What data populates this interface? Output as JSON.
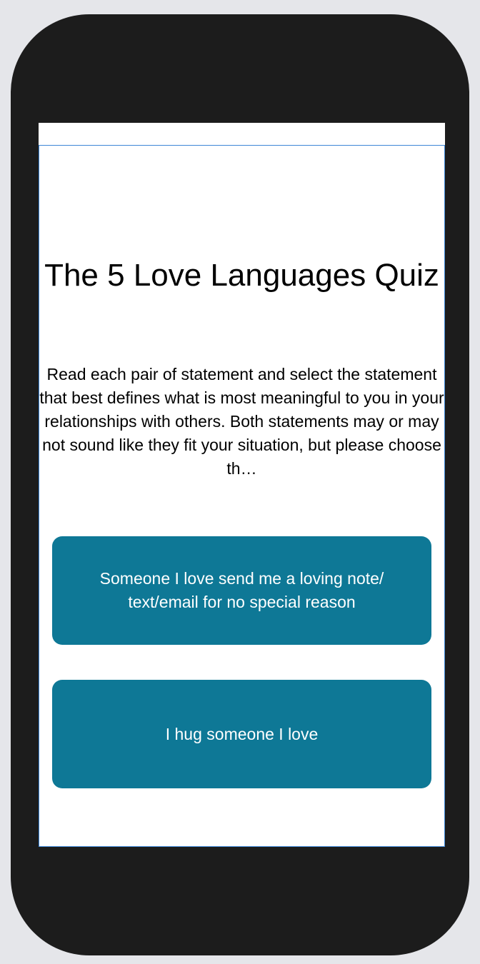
{
  "quiz": {
    "title": "The 5 Love Languages Quiz",
    "description": "Read each pair of statement and select the statement that best defines what is most meaningful to you in your relationships with others. Both statements may or may not sound like they fit your situation, but please choose th…",
    "options": [
      {
        "label": "Someone I love send me a loving note/ text/email for no special reason"
      },
      {
        "label": "I hug someone I love"
      }
    ]
  },
  "colors": {
    "button": "#0e7896",
    "button_text": "#ffffff",
    "device_frame": "#1c1c1c",
    "page_background": "#e5e6ea",
    "screen_border": "#3d86d6"
  }
}
